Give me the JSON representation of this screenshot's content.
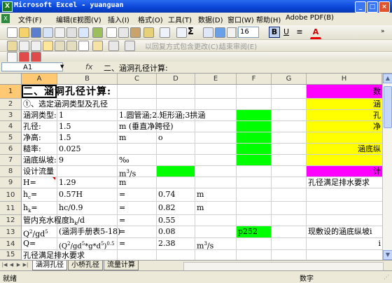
{
  "window": {
    "title": "Microsoft Excel - yuanguan"
  },
  "menu": [
    "文件(F)",
    "编辑(E)",
    "视图(V)",
    "插入(I)",
    "格式(O)",
    "工具(T)",
    "数据(D)",
    "窗口(W)",
    "帮助(H)",
    "Adobe PDF(B)"
  ],
  "toolbar": {
    "font_size": "16",
    "bold": "B",
    "underline": "U",
    "font_color": "A",
    "sigma": "Σ",
    "review_text": "以回复方式包含更改(C)...",
    "review_end": "结束审阅(E)"
  },
  "formula_bar": {
    "name_box": "A1",
    "fx": "fx",
    "value": "二、涵洞孔径计算:"
  },
  "columns": [
    "A",
    "B",
    "C",
    "D",
    "E",
    "F",
    "G",
    "H"
  ],
  "rows": [
    "1",
    "2",
    "3",
    "4",
    "5",
    "6",
    "7",
    "8",
    "9",
    "10",
    "11",
    "12",
    "13",
    "14",
    "15"
  ],
  "cells": {
    "A1": "二、涵洞孔径计算:",
    "A2": "①、选定涵洞类型及孔径",
    "A3": "涵洞类型:",
    "B3": "1",
    "C3": "1.圆管涵;2.矩形涵;3拱涵",
    "A4": "孔径:",
    "B4": "1.5",
    "C4": "m (垂直净跨径)",
    "A5": "净高:",
    "B5": "1.5",
    "C5": "m",
    "D5": "o",
    "A6": "糙率:",
    "B6": "0.025",
    "A7": "涵底纵坡:",
    "B7": "9",
    "C7": "‰",
    "A8": "设计流量",
    "C8_base": "m",
    "C8_sup": "3",
    "C8_tail": "/s",
    "A9": "H=",
    "B9": "1.29",
    "C9": "m",
    "A10_base": "h",
    "A10_sub": "c",
    "A10_tail": "=",
    "B10": "0.57H",
    "C10": "=",
    "D10": "0.74",
    "E10": "m",
    "A11_base": "h",
    "A11_sub": "k",
    "A11_tail": "=",
    "B11": "hc/0.9",
    "C11": "=",
    "D11": "0.82",
    "E11": "m",
    "A12": "管内充水程度h",
    "A12_sub": "k",
    "A12_tail": "/d",
    "C12": "=",
    "D12": "0.55",
    "A13": "Q",
    "A13_sup": "2",
    "A13_mid": "/gd",
    "A13_sup2": "5",
    "B13": "(涵洞手册表5-18)",
    "C13": "=",
    "D13": "0.08",
    "F13": "p252",
    "A14": "Q=",
    "B14": "(Q",
    "B14_sup": "2",
    "B14_mid": "/gd",
    "B14_sup2": "5",
    "B14_mid2": "*g*d",
    "B14_sup3": "5",
    "B14_tail": ")",
    "B14_sup4": "0.5",
    "C14": "=",
    "D14": "2.38",
    "E14_base": "m",
    "E14_sup": "3",
    "E14_tail": "/s",
    "A15": "孔径满足排水要求",
    "H1": "数",
    "H2": "涵",
    "H3": "孔",
    "H4": "净",
    "H6": "涵底纵",
    "H8": "计",
    "H9": "孔径满足排水要求",
    "H13": "现敷设的涵底纵坡i",
    "H14": "i"
  },
  "sheet_tabs": [
    "涵洞孔径",
    "小桥孔径",
    "流量计算"
  ],
  "status": {
    "left": "就绪",
    "right": "数字"
  },
  "colors": {
    "green": "#00ff00",
    "yellow": "#ffff00",
    "magenta": "#ff00ff",
    "selected_header": "#ffc973"
  }
}
